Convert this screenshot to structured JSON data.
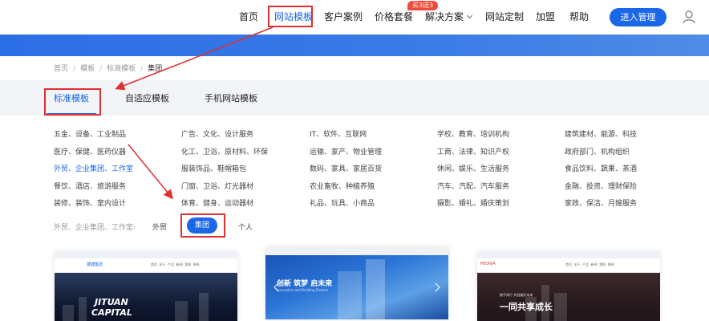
{
  "nav": {
    "items": [
      "首页",
      "网站模板",
      "客户案例",
      "价格套餐",
      "解决方案",
      "网站定制",
      "加盟",
      "帮助"
    ],
    "promo_badge": "买3送3",
    "cta": "进入管理",
    "icons": {
      "user": "user-icon",
      "dropdown": "chevron-down-icon"
    }
  },
  "breadcrumb": [
    "首页",
    "模板",
    "标准模板",
    "集团"
  ],
  "tabs": [
    "标准模板",
    "自适应模板",
    "手机网站模板"
  ],
  "categories": [
    [
      "五金、设备、工业制品",
      "医疗、保健、医药仪器",
      "外贸、企业集团、工作室",
      "餐饮、酒店、旅游服务",
      "装修、装饰、室内设计"
    ],
    [
      "广告、文化、设计服务",
      "化工、卫浴、原材料、环保",
      "服装饰品、鞋帽箱包",
      "门窗、卫浴、灯光器材",
      "体育、健身、运动器材"
    ],
    [
      "IT、软件、互联网",
      "运输、家产、物业管理",
      "数码、家具、家居百货",
      "农业畜牧、种植养殖",
      "礼品、玩具、小商品"
    ],
    [
      "学校、教育、培训机构",
      "工商、法律、知识产权",
      "休闲、娱乐、生活服务",
      "汽车、汽配、汽车服务",
      "摄影、婚礼、婚庆策划"
    ],
    [
      "建筑建材、能源、科技",
      "政府部门、机构组织",
      "食品饮料、蔬果、茶酒",
      "金融、投资、理财保险",
      "家政、保洁、月嫂服务"
    ]
  ],
  "sub_filter": {
    "label": "外贸、企业集团、工作室:",
    "options": [
      "外贸",
      "集团",
      "个人"
    ],
    "active": "集团"
  },
  "cards": [
    {
      "logo": "捷捷集团",
      "menu": [
        "首页",
        "关于",
        "产品",
        "新闻",
        "案例",
        "联系"
      ],
      "headline": "JITUAN",
      "headline2": "CAPITAL"
    },
    {
      "headline": "创新 筑梦 启未来",
      "sub": "Innovation and Building Dreams"
    },
    {
      "logo": "PEONIA",
      "menu": [
        "首页",
        "关于",
        "产品",
        "新闻",
        "案例",
        "联系"
      ],
      "sub": "携手同行 共创美好未来",
      "headline": "一同共享成长"
    }
  ],
  "colors": {
    "accent": "#1a67e8",
    "annotation": "#e03030",
    "badge": "#ef4b3b"
  }
}
